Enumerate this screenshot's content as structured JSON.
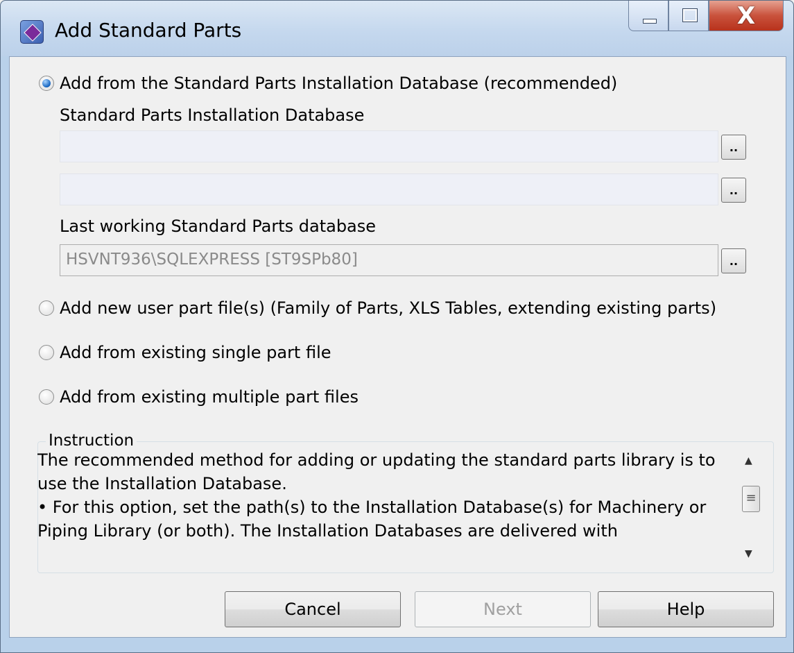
{
  "window": {
    "title": "Add Standard Parts",
    "close_glyph": "X",
    "buttons": [
      "minimize",
      "maximize",
      "close"
    ]
  },
  "options": {
    "install_db": {
      "label": "Add from the Standard Parts Installation Database (recommended)",
      "selected": true
    },
    "new_user_part": {
      "label": "Add new user part file(s) (Family of Parts, XLS Tables, extending existing parts)",
      "selected": false
    },
    "single_part": {
      "label": "Add from existing single part file",
      "selected": false
    },
    "multiple_parts": {
      "label": "Add from existing multiple part files",
      "selected": false
    }
  },
  "install_db_section": {
    "heading": "Standard Parts Installation Database",
    "path1": "",
    "path2": "",
    "browse_label": ".."
  },
  "last_working": {
    "label": "Last working Standard Parts database",
    "value": "HSVNT936\\SQLEXPRESS [ST9SPb80]"
  },
  "instruction": {
    "legend": "Instruction",
    "para1": "The recommended method for adding or updating the standard parts library is to use the Installation Database.",
    "para2": "  • For this option, set the path(s) to the Installation Database(s) for Machinery or Piping Library (or both). The Installation Databases are delivered with"
  },
  "footer": {
    "cancel": "Cancel",
    "next": "Next",
    "help": "Help"
  },
  "icons": {
    "app": "add-standard-parts-app-icon",
    "scroll_up": "▲",
    "scroll_down": "▼",
    "scroll_thumb": "≡"
  }
}
